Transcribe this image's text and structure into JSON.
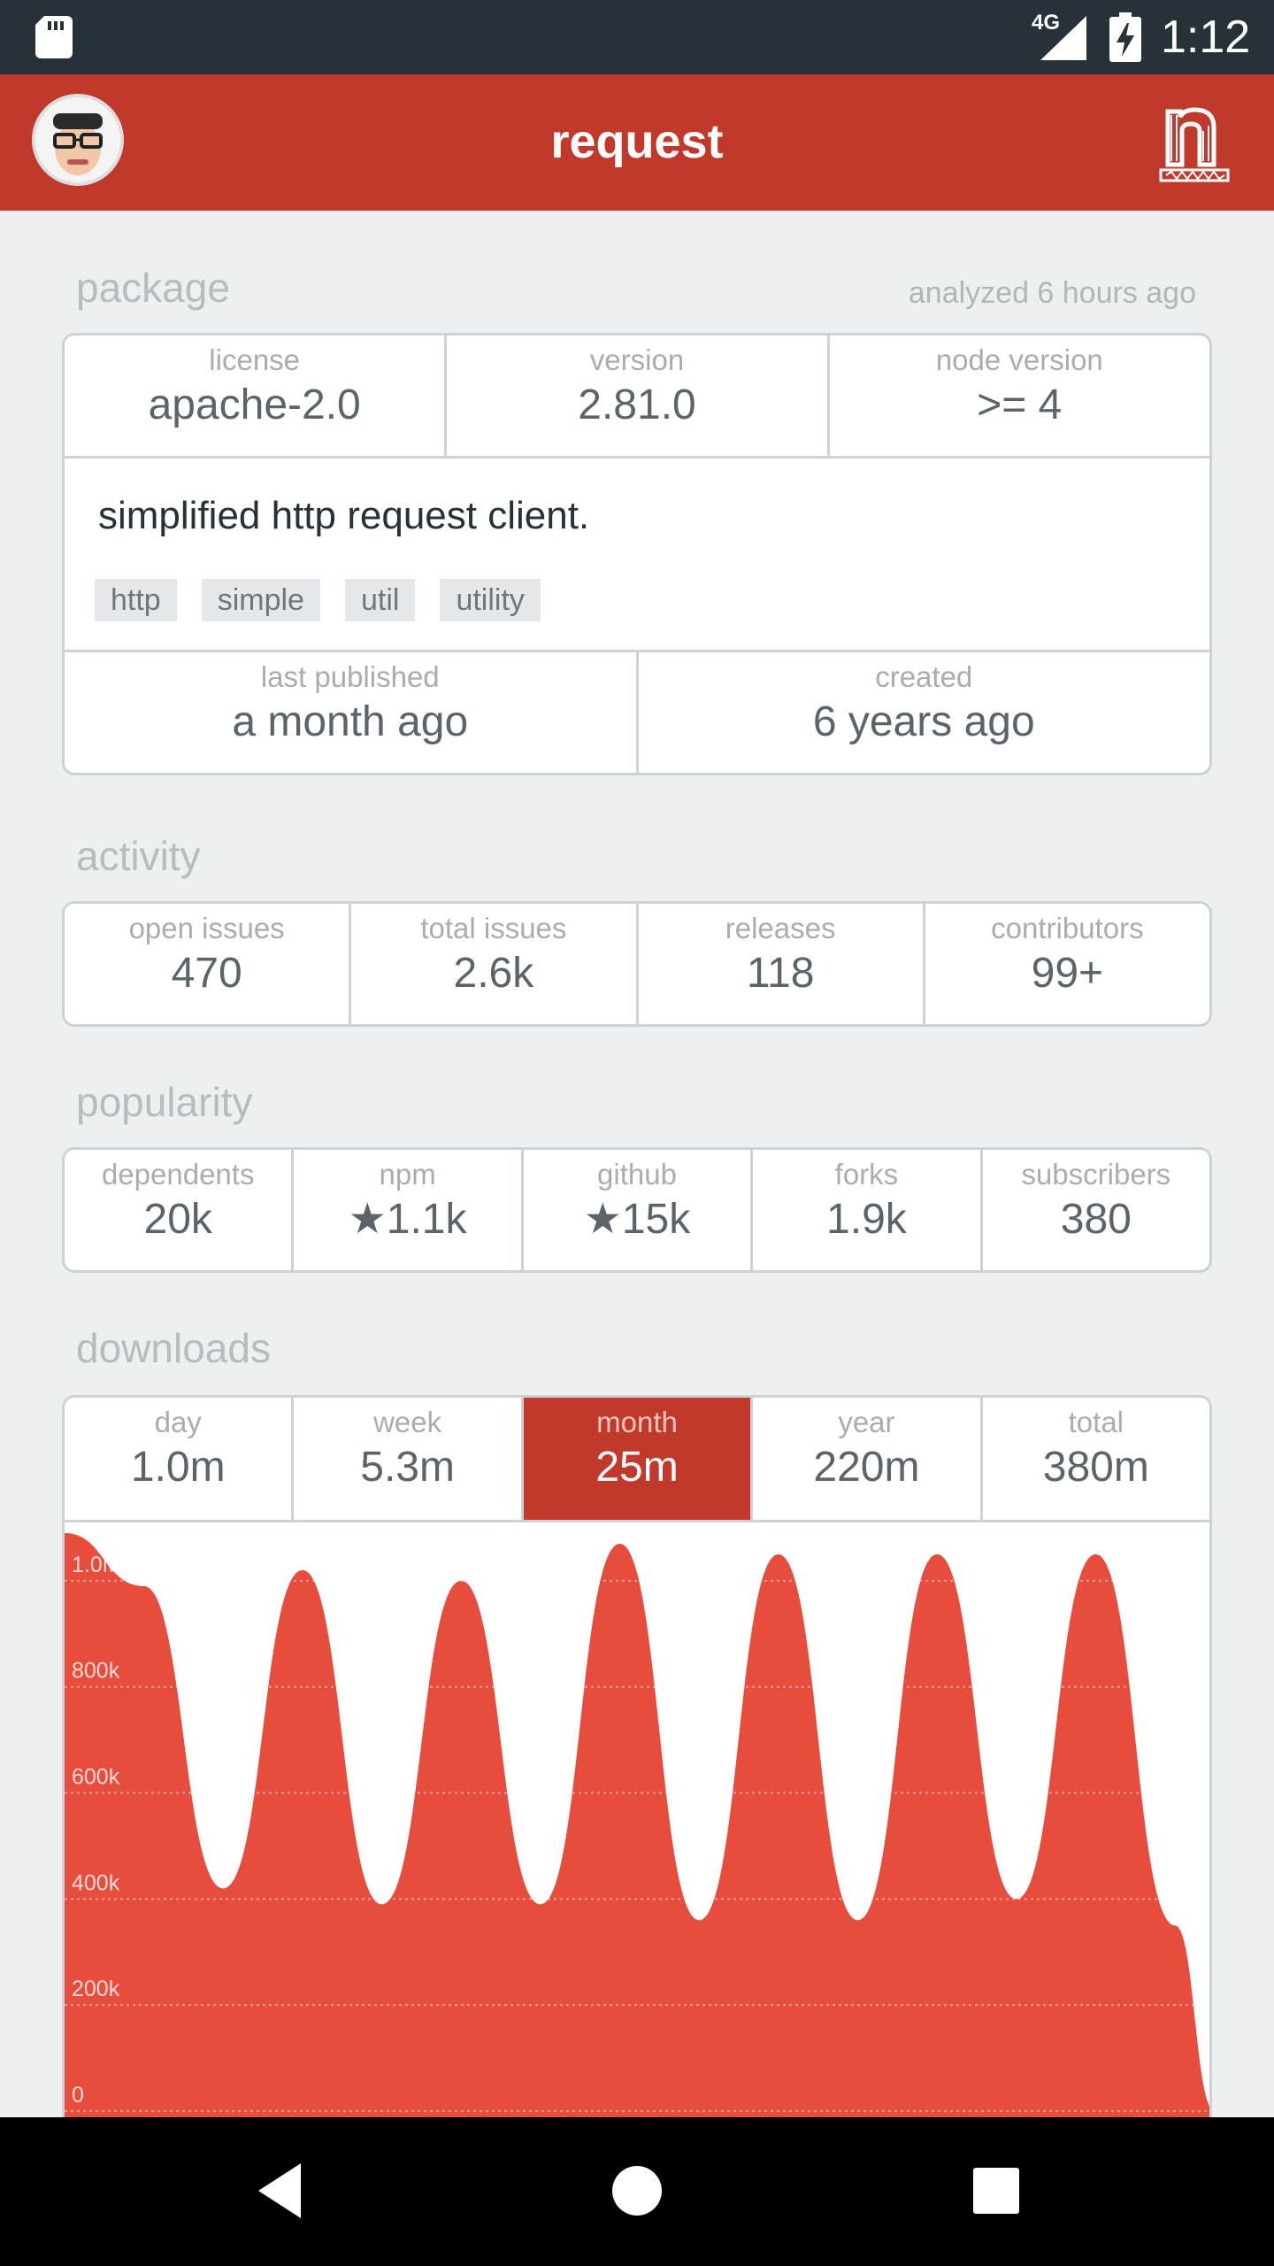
{
  "status_bar": {
    "network": "4G",
    "time": "1:12"
  },
  "app_bar": {
    "title": "request"
  },
  "package": {
    "section_title": "package",
    "analyzed": "analyzed 6 hours ago",
    "license_label": "license",
    "license": "apache-2.0",
    "version_label": "version",
    "version": "2.81.0",
    "node_label": "node version",
    "node": ">= 4",
    "description": "simplified http request client.",
    "tags": [
      "http",
      "simple",
      "util",
      "utility"
    ],
    "last_published_label": "last published",
    "last_published": "a month ago",
    "created_label": "created",
    "created": "6 years ago"
  },
  "activity": {
    "section_title": "activity",
    "items": [
      {
        "label": "open issues",
        "value": "470"
      },
      {
        "label": "total issues",
        "value": "2.6k"
      },
      {
        "label": "releases",
        "value": "118"
      },
      {
        "label": "contributors",
        "value": "99+"
      }
    ]
  },
  "popularity": {
    "section_title": "popularity",
    "items": [
      {
        "label": "dependents",
        "value": "20k"
      },
      {
        "label": "npm",
        "value": "★1.1k"
      },
      {
        "label": "github",
        "value": "★15k"
      },
      {
        "label": "forks",
        "value": "1.9k"
      },
      {
        "label": "subscribers",
        "value": "380"
      }
    ]
  },
  "downloads": {
    "section_title": "downloads",
    "tabs": [
      {
        "label": "day",
        "value": "1.0m",
        "active": false
      },
      {
        "label": "week",
        "value": "5.3m",
        "active": false
      },
      {
        "label": "month",
        "value": "25m",
        "active": true
      },
      {
        "label": "year",
        "value": "220m",
        "active": false
      },
      {
        "label": "total",
        "value": "380m",
        "active": false
      }
    ]
  },
  "chart_data": {
    "type": "area",
    "y_ticks": [
      "1.0M",
      "800k",
      "600k",
      "400k",
      "200k",
      "0"
    ],
    "y_tick_values": [
      1000000,
      800000,
      600000,
      400000,
      200000,
      0
    ],
    "ylim": [
      0,
      1100000
    ],
    "grid": true,
    "x_index": [
      0,
      2,
      4,
      6,
      8,
      10,
      12,
      14,
      16,
      18,
      20,
      22,
      24,
      26,
      28,
      29
    ],
    "values": [
      1090000,
      990000,
      420000,
      1020000,
      390000,
      1000000,
      390000,
      1070000,
      360000,
      1050000,
      360000,
      1050000,
      400000,
      1050000,
      350000,
      0
    ],
    "color": "#e74c3c"
  },
  "colors": {
    "brand": "#c0392b",
    "chart_fill": "#e74c3c",
    "status_bar": "#263238"
  }
}
